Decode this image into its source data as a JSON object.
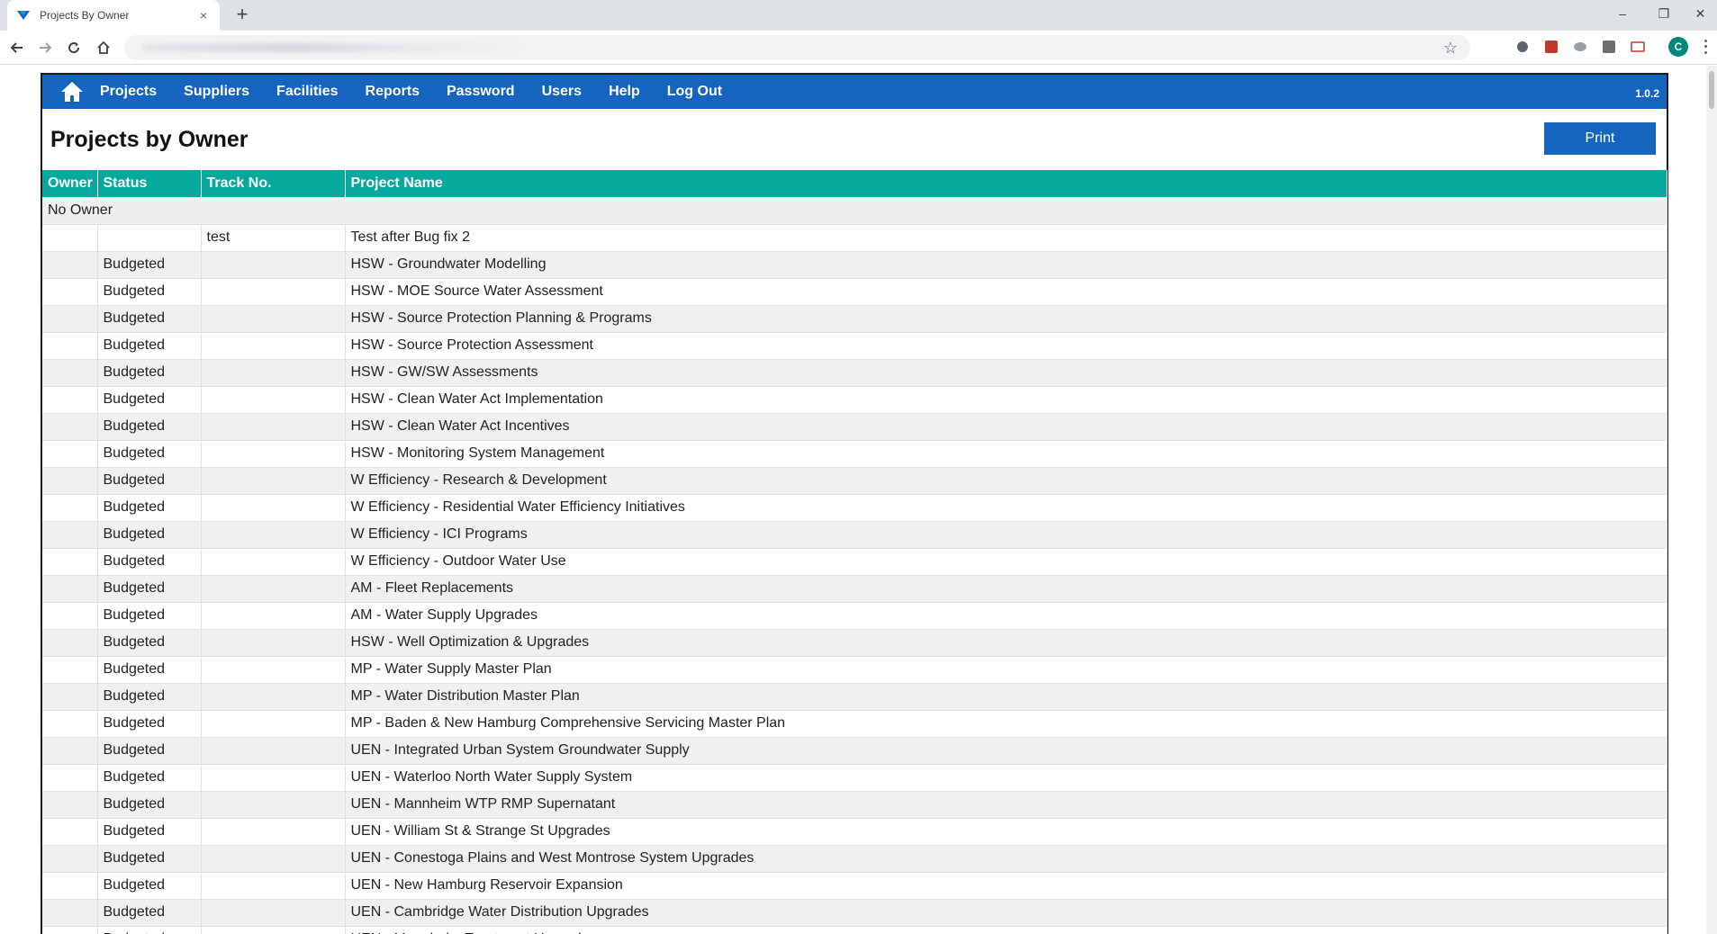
{
  "browser": {
    "tab_title": "Projects By Owner",
    "tab_close": "×",
    "new_tab": "+",
    "window_controls": {
      "minimize": "–",
      "restore": "❐",
      "close": "✕"
    },
    "profile_initial": "C"
  },
  "nav": {
    "home_icon": "home-icon",
    "items": [
      "Projects",
      "Suppliers",
      "Facilities",
      "Reports",
      "Password",
      "Users",
      "Help",
      "Log Out"
    ],
    "version": "1.0.2",
    "accent_color": "#1565c0"
  },
  "page": {
    "title": "Projects by Owner",
    "print_label": "Print"
  },
  "table": {
    "header_color": "#05a99d",
    "columns": [
      "Owner",
      "Status",
      "Track No.",
      "Project Name"
    ],
    "group_label": "No Owner",
    "rows": [
      {
        "owner": "",
        "status": "",
        "track": "test",
        "name": "Test after Bug fix 2"
      },
      {
        "owner": "",
        "status": "Budgeted",
        "track": "",
        "name": "HSW - Groundwater Modelling"
      },
      {
        "owner": "",
        "status": "Budgeted",
        "track": "",
        "name": "HSW - MOE Source Water Assessment"
      },
      {
        "owner": "",
        "status": "Budgeted",
        "track": "",
        "name": "HSW - Source Protection Planning & Programs"
      },
      {
        "owner": "",
        "status": "Budgeted",
        "track": "",
        "name": "HSW - Source Protection Assessment"
      },
      {
        "owner": "",
        "status": "Budgeted",
        "track": "",
        "name": "HSW - GW/SW Assessments"
      },
      {
        "owner": "",
        "status": "Budgeted",
        "track": "",
        "name": "HSW - Clean Water Act Implementation"
      },
      {
        "owner": "",
        "status": "Budgeted",
        "track": "",
        "name": "HSW - Clean Water Act Incentives"
      },
      {
        "owner": "",
        "status": "Budgeted",
        "track": "",
        "name": "HSW - Monitoring System Management"
      },
      {
        "owner": "",
        "status": "Budgeted",
        "track": "",
        "name": "W Efficiency - Research & Development"
      },
      {
        "owner": "",
        "status": "Budgeted",
        "track": "",
        "name": "W Efficiency - Residential Water Efficiency Initiatives"
      },
      {
        "owner": "",
        "status": "Budgeted",
        "track": "",
        "name": "W Efficiency - ICI Programs"
      },
      {
        "owner": "",
        "status": "Budgeted",
        "track": "",
        "name": "W Efficiency - Outdoor Water Use"
      },
      {
        "owner": "",
        "status": "Budgeted",
        "track": "",
        "name": "AM - Fleet Replacements"
      },
      {
        "owner": "",
        "status": "Budgeted",
        "track": "",
        "name": "AM - Water Supply Upgrades"
      },
      {
        "owner": "",
        "status": "Budgeted",
        "track": "",
        "name": "HSW - Well Optimization & Upgrades"
      },
      {
        "owner": "",
        "status": "Budgeted",
        "track": "",
        "name": "MP - Water Supply Master Plan"
      },
      {
        "owner": "",
        "status": "Budgeted",
        "track": "",
        "name": "MP - Water Distribution Master Plan"
      },
      {
        "owner": "",
        "status": "Budgeted",
        "track": "",
        "name": "MP - Baden & New Hamburg Comprehensive Servicing Master Plan"
      },
      {
        "owner": "",
        "status": "Budgeted",
        "track": "",
        "name": "UEN - Integrated Urban System Groundwater Supply"
      },
      {
        "owner": "",
        "status": "Budgeted",
        "track": "",
        "name": "UEN - Waterloo North Water Supply System"
      },
      {
        "owner": "",
        "status": "Budgeted",
        "track": "",
        "name": "UEN - Mannheim WTP RMP Supernatant"
      },
      {
        "owner": "",
        "status": "Budgeted",
        "track": "",
        "name": "UEN - William St & Strange St Upgrades"
      },
      {
        "owner": "",
        "status": "Budgeted",
        "track": "",
        "name": "UEN - Conestoga Plains and West Montrose System Upgrades"
      },
      {
        "owner": "",
        "status": "Budgeted",
        "track": "",
        "name": "UEN - New Hamburg Reservoir Expansion"
      },
      {
        "owner": "",
        "status": "Budgeted",
        "track": "",
        "name": "UEN - Cambridge Water Distribution Upgrades"
      },
      {
        "owner": "",
        "status": "Budgeted",
        "track": "",
        "name": "UEN - Mannheim Treatment Upgrades"
      }
    ]
  }
}
